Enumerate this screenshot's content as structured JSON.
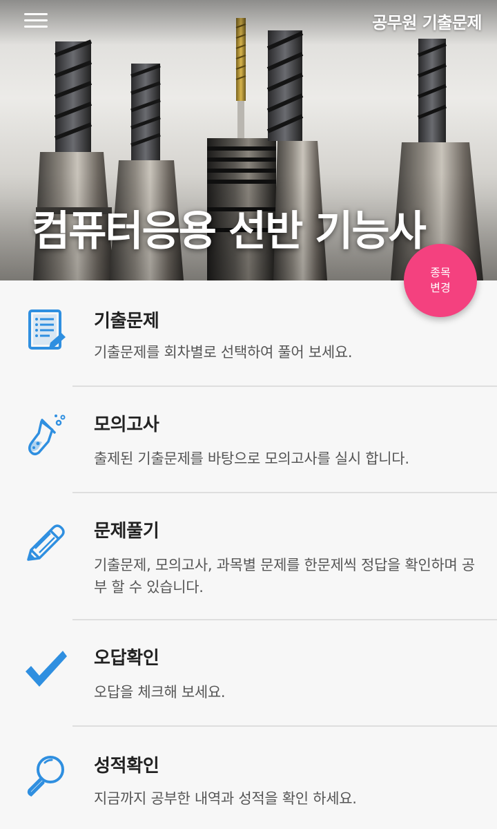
{
  "header": {
    "app_title": "공무원 기출문제",
    "hero_title": "컴퓨터응용 선반 기능사",
    "menu_icon": "hamburger-menu-icon"
  },
  "fab": {
    "line1": "종목",
    "line2": "변경",
    "color": "#f4417f"
  },
  "accent_color": "#2f8fe0",
  "menu": [
    {
      "title": "기출문제",
      "desc": "기출문제를 회차별로 선택하여 풀어 보세요.",
      "icon": "document-list-icon"
    },
    {
      "title": "모의고사",
      "desc": "출제된 기출문제를 바탕으로 모의고사를 실시 합니다.",
      "icon": "flask-icon"
    },
    {
      "title": "문제풀기",
      "desc": "기출문제, 모의고사, 과목별 문제를 한문제씩 정답을 확인하며 공부 할 수 있습니다.",
      "icon": "pencil-icon"
    },
    {
      "title": "오답확인",
      "desc": "오답을 체크해 보세요.",
      "icon": "checkmark-icon"
    },
    {
      "title": "성적확인",
      "desc": "지금까지 공부한 내역과 성적을 확인 하세요.",
      "icon": "magnifier-icon"
    }
  ]
}
